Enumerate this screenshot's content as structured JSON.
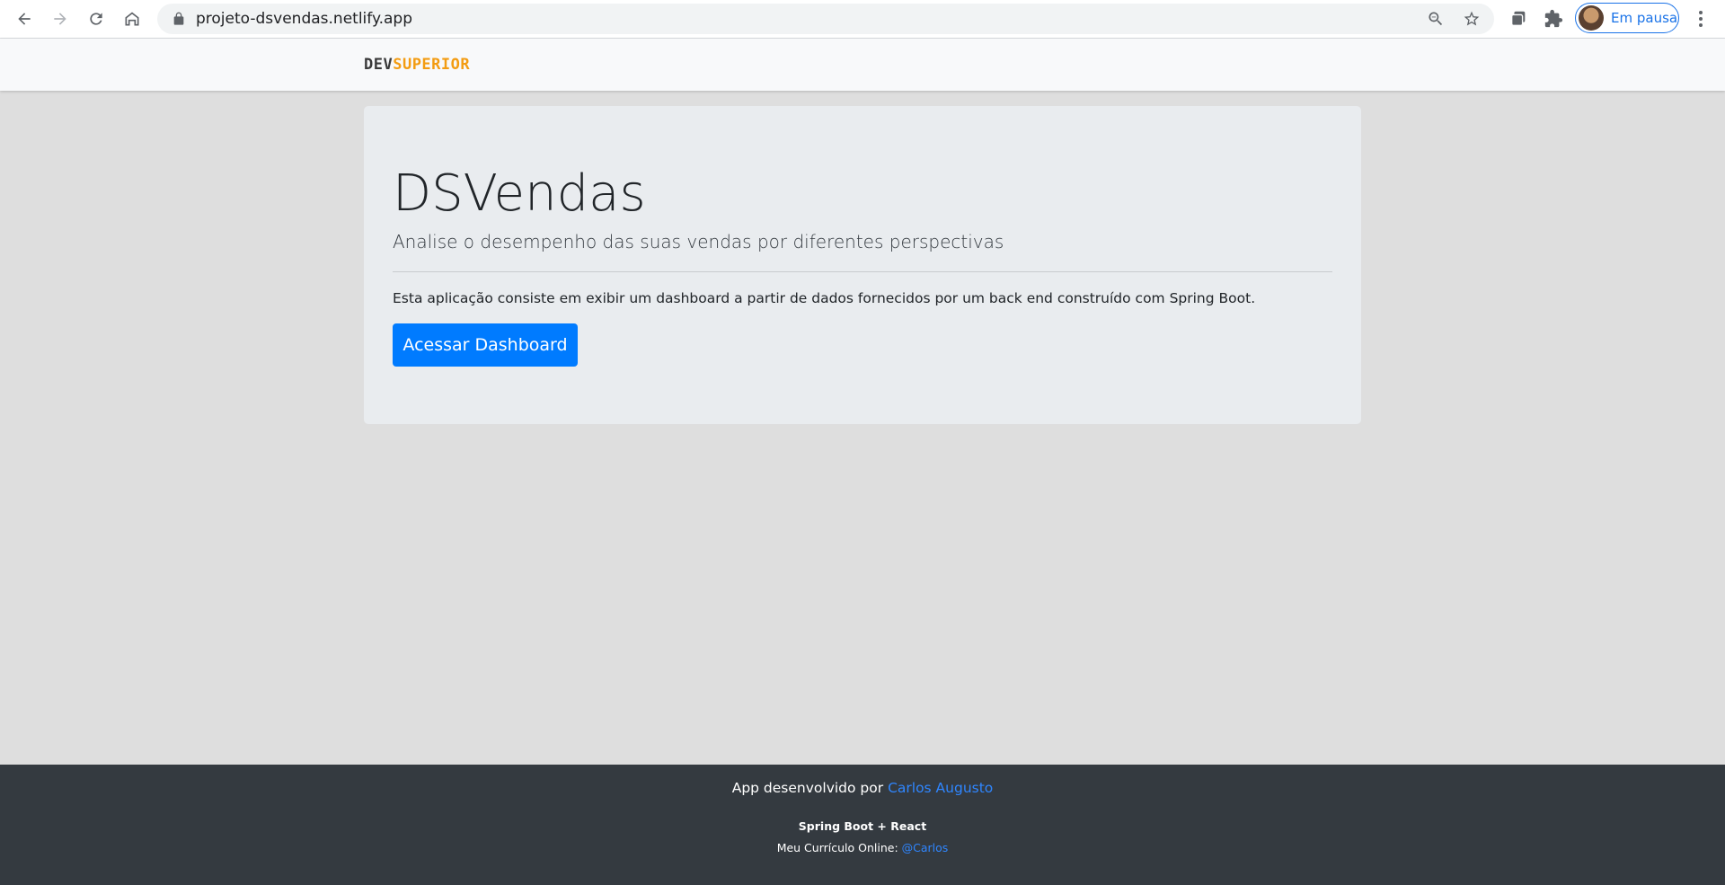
{
  "browser": {
    "url": "projeto-dsvendas.netlify.app",
    "profile_status": "Em pausa",
    "icons": [
      "back-icon",
      "forward-icon",
      "reload-icon",
      "home-icon",
      "lock-icon",
      "zoom-icon",
      "star-icon",
      "tab-search-icon",
      "extensions-icon",
      "more-icon"
    ],
    "colors": {
      "accent": "#1a73e8",
      "omnibox_bg": "#f1f3f4"
    }
  },
  "header": {
    "logo_part1": "DEV",
    "logo_part2": "SUPERIOR"
  },
  "jumbotron": {
    "title": "DSVendas",
    "lead": "Analise o desempenho das suas vendas por diferentes perspectivas",
    "description": "Esta aplicação consiste em exibir um dashboard a partir de dados fornecidos por um back end construído com Spring Boot.",
    "button_label": "Acessar Dashboard"
  },
  "footer": {
    "credit_prefix": "App desenvolvido por ",
    "credit_name": "Carlos Augusto",
    "tech": "Spring Boot + React",
    "cv_prefix": "Meu Currículo Online: ",
    "cv_link": "@Carlos"
  },
  "colors": {
    "primary": "#007bff",
    "logo_accent": "#f39c12",
    "footer_bg": "#343a40",
    "page_bg": "#dedede"
  }
}
